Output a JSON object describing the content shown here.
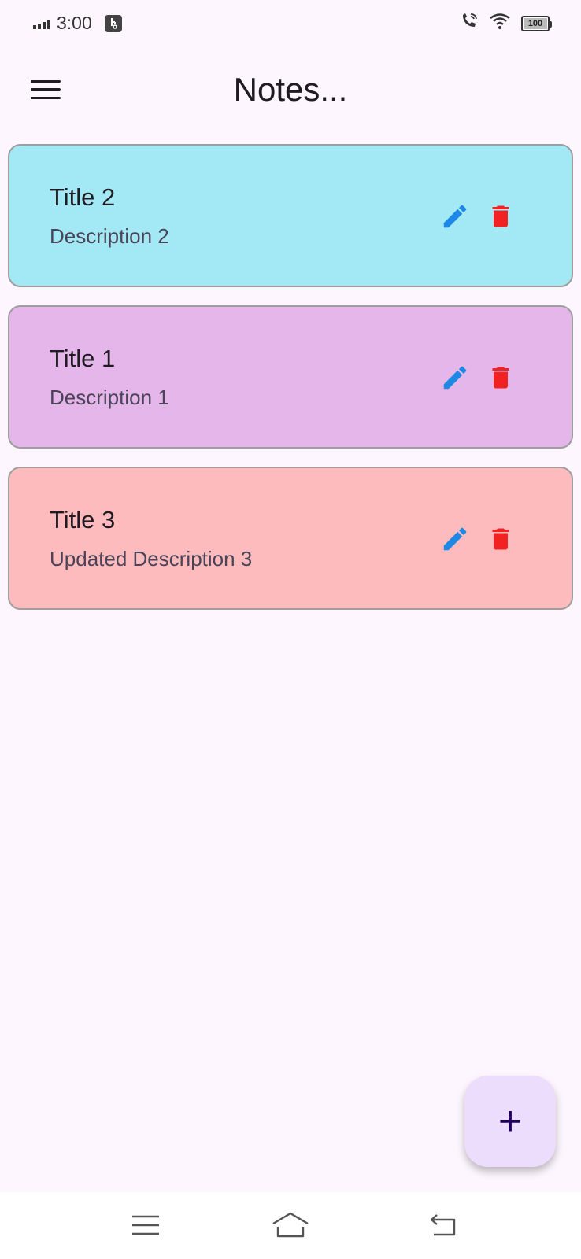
{
  "status_bar": {
    "time": "3:00",
    "battery": "100"
  },
  "app_bar": {
    "title": "Notes..."
  },
  "notes": [
    {
      "title": "Title 2",
      "description": "Description 2",
      "color": "#a3e8f5"
    },
    {
      "title": "Title 1",
      "description": "Description 1",
      "color": "#e5b6ea"
    },
    {
      "title": "Title 3",
      "description": "Updated Description 3",
      "color": "#febbbd"
    }
  ],
  "fab": {
    "label": "+"
  },
  "colors": {
    "background": "#fdf6fe",
    "edit_icon": "#1e88e5",
    "delete_icon": "#f32222",
    "fab_background": "#ecddfd"
  },
  "icons": {
    "menu": "hamburger-icon",
    "edit": "pencil-icon",
    "delete": "trash-icon",
    "add": "plus-icon"
  }
}
